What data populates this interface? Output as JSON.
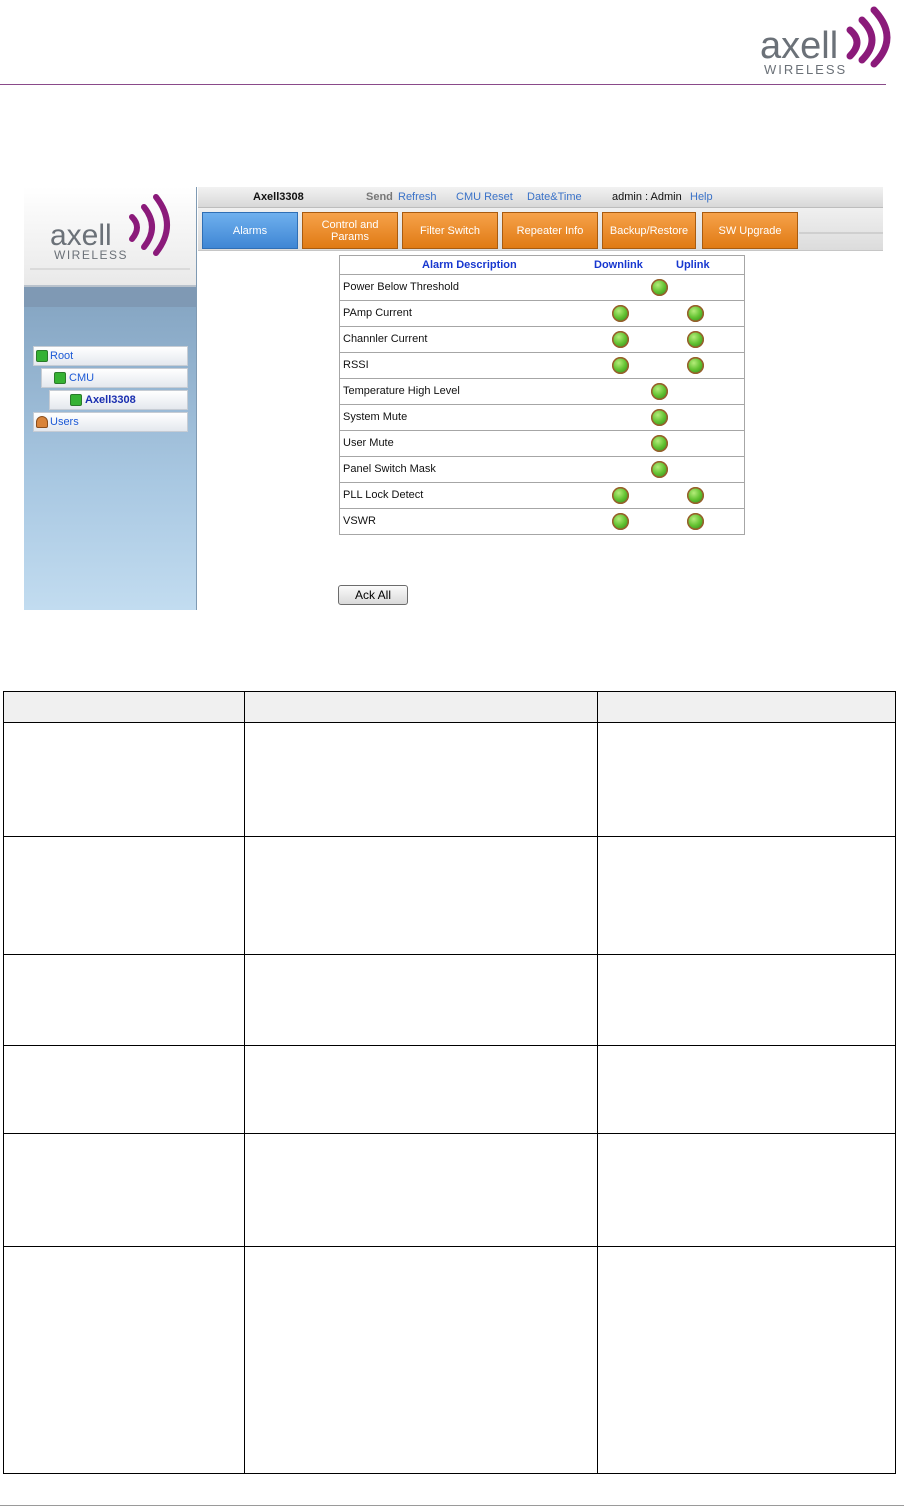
{
  "brand": {
    "name": "axell",
    "tagline": "WIRELESS"
  },
  "topbar": {
    "device": "Axell3308",
    "send": "Send",
    "refresh": "Refresh",
    "cmu_reset": "CMU Reset",
    "date_time": "Date&Time",
    "user": "admin : Admin",
    "help": "Help"
  },
  "tabs": [
    {
      "label": "Alarms",
      "active": true
    },
    {
      "label": "Control and Params"
    },
    {
      "label": "Filter Switch"
    },
    {
      "label": "Repeater Info"
    },
    {
      "label": "Backup/Restore"
    },
    {
      "label": "SW Upgrade"
    }
  ],
  "tree": {
    "root": "Root",
    "cmu": "CMU",
    "device": "Axell3308",
    "users": "Users"
  },
  "alarm_table": {
    "col_description": "Alarm Description",
    "col_downlink": "Downlink",
    "col_uplink": "Uplink",
    "rows": [
      {
        "name": "Power Below Threshold",
        "leds": "single"
      },
      {
        "name": "PAmp Current",
        "leds": "both"
      },
      {
        "name": "Channler Current",
        "leds": "both"
      },
      {
        "name": "RSSI",
        "leds": "both"
      },
      {
        "name": "Temperature High Level",
        "leds": "single"
      },
      {
        "name": "System Mute",
        "leds": "single"
      },
      {
        "name": "User Mute",
        "leds": "single"
      },
      {
        "name": "Panel Switch Mask",
        "leds": "single"
      },
      {
        "name": "PLL Lock Detect",
        "leds": "both"
      },
      {
        "name": "VSWR",
        "leds": "both"
      }
    ]
  },
  "ack_all": "Ack All",
  "colors": {
    "brand_purple": "#8b1a7a",
    "tab_orange": "#e98a26",
    "tab_blue": "#4a8fdc",
    "led_green": "#5cbf2a"
  }
}
